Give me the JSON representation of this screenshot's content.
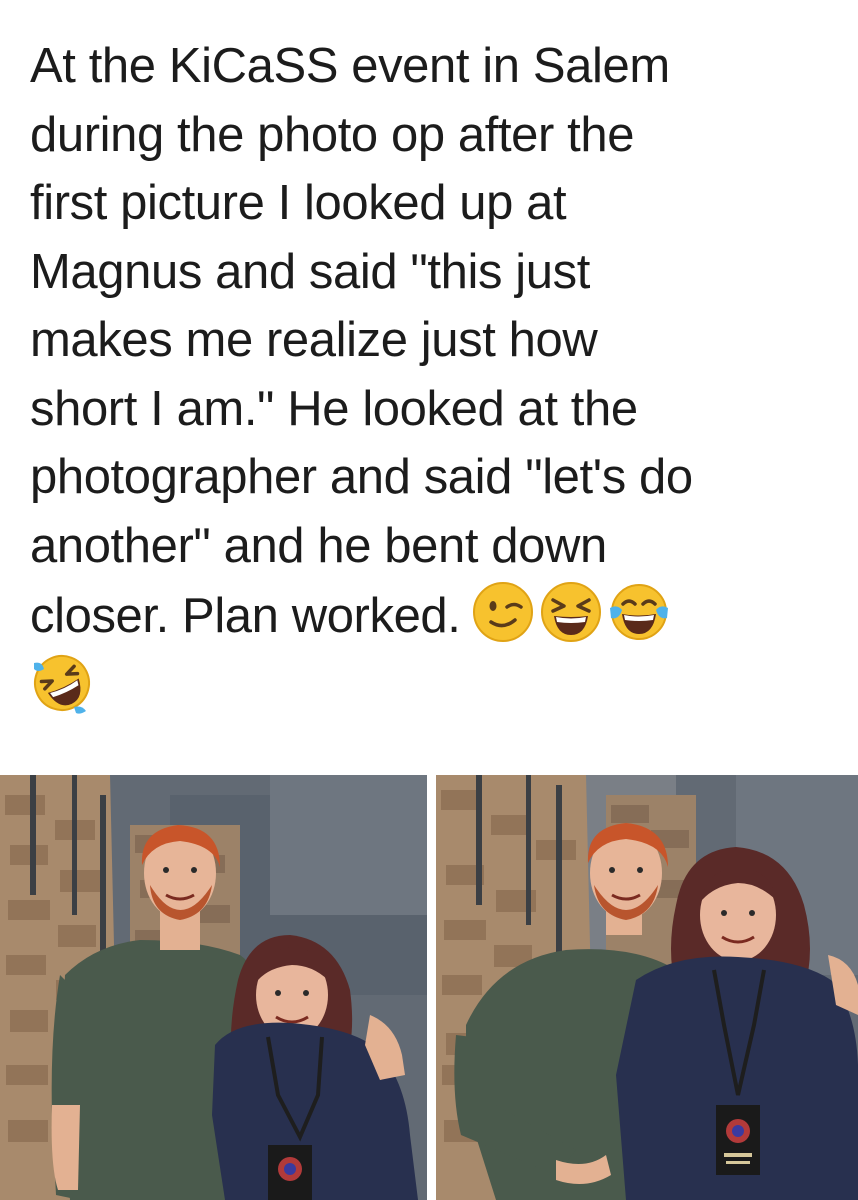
{
  "post": {
    "lines": [
      "At the KiCaSS event in Salem",
      "during the photo op after the",
      "first picture I looked up at",
      "Magnus and said \"this just",
      "makes me realize just how",
      "short I am.\"  He looked at the",
      "photographer and said \"let's do",
      "another\" and he bent down",
      "closer. Plan worked."
    ],
    "emojis": [
      "winking-face",
      "grinning-squinting-face",
      "face-with-tears-of-joy",
      "rolling-on-floor-laughing"
    ]
  },
  "photos": [
    {
      "name": "photo-op-first"
    },
    {
      "name": "photo-op-second"
    }
  ],
  "colors": {
    "text": "#1c1c1c",
    "background": "#ffffff",
    "emoji_yellow": "#f7c22e",
    "tshirt_green": "#4a5a4c",
    "top_navy": "#28304f",
    "hair_red": "#c8552a",
    "wall_stone": "#a88a6c"
  }
}
